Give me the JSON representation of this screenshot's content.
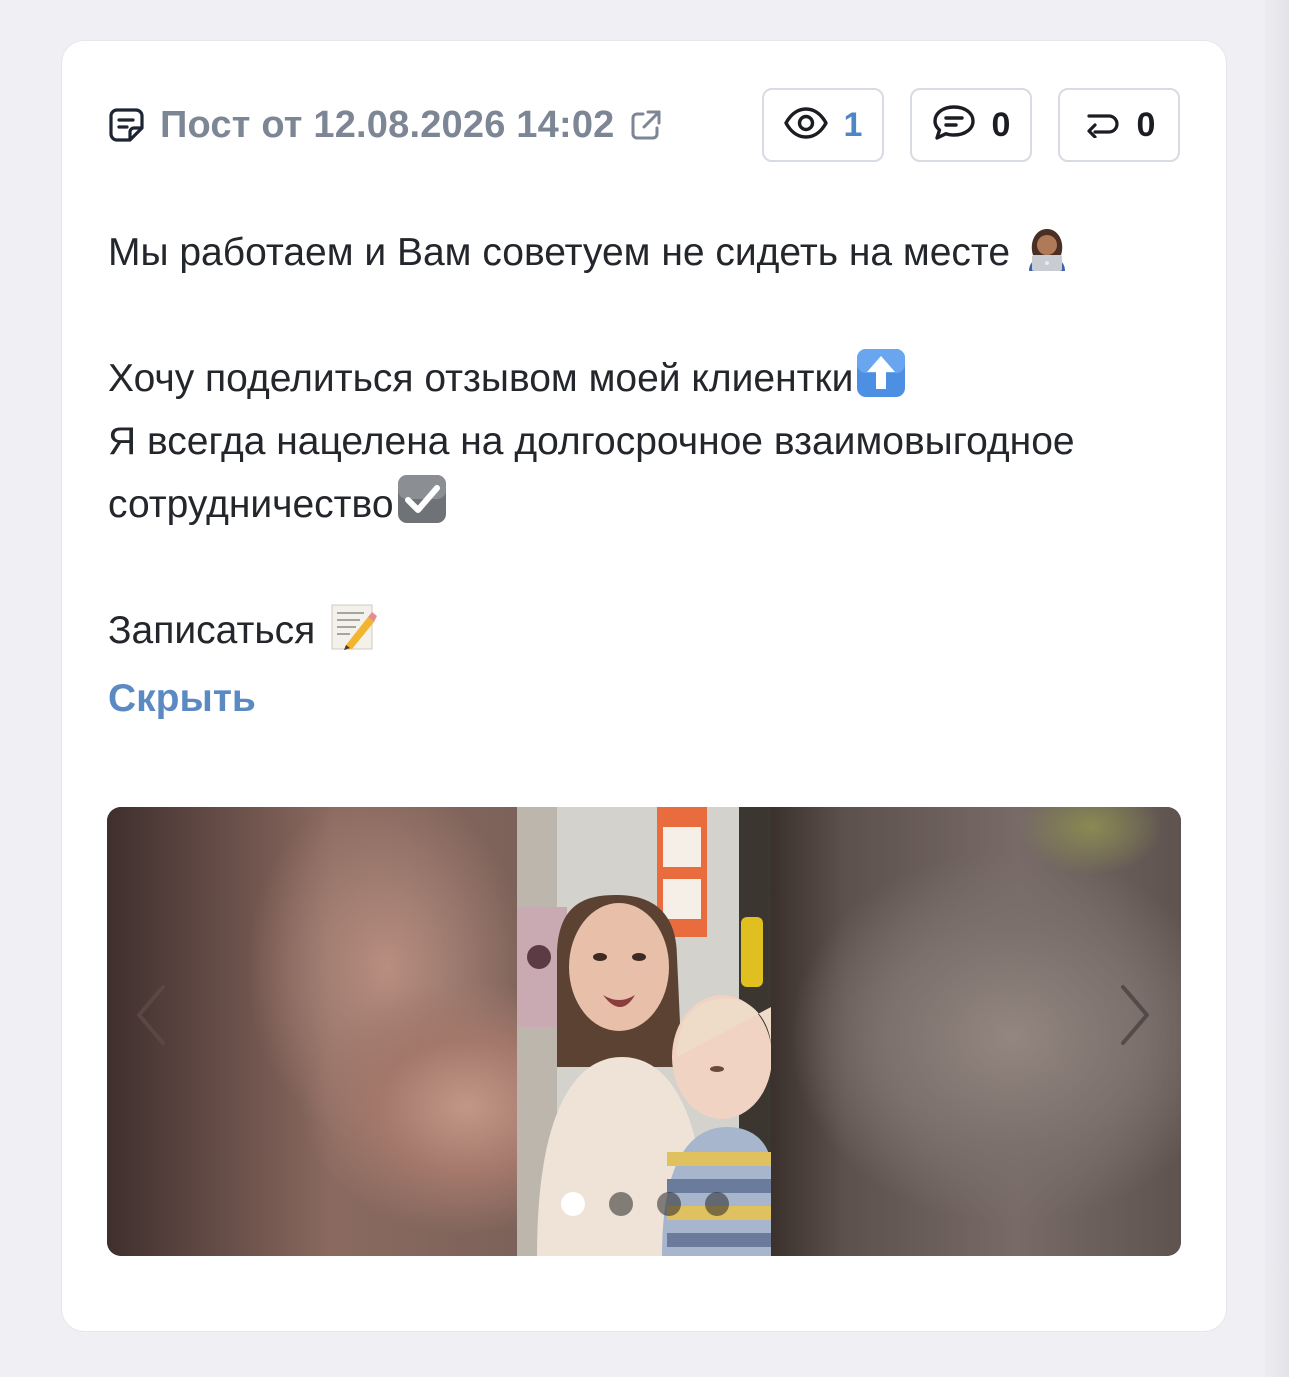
{
  "post": {
    "title": "Пост от 12.08.2026 14:02",
    "stats": {
      "views": "1",
      "comments": "0",
      "reposts": "0"
    },
    "text": {
      "line1": "Мы работаем и Вам советуем не сидеть на месте ",
      "line2": "Хочу поделиться отзывом моей клиентки",
      "line3": "Я всегда нацелена на долгосрочное взаимовыгодное",
      "line4": "сотрудничество",
      "line5": "Записаться "
    },
    "hide_label": "Скрыть"
  },
  "icons": {
    "post": "note-icon",
    "external": "external-link-icon",
    "views": "eye-icon",
    "comments": "comment-icon",
    "reposts": "repost-icon",
    "emoji1": "woman-technologist-emoji",
    "emoji2": "up-arrow-emoji",
    "emoji3": "check-box-emoji",
    "emoji4": "memo-emoji"
  },
  "carousel": {
    "slide_count": 4,
    "active_index": 0
  },
  "colors": {
    "accent": "#5b8ac3",
    "views_value": "#4f86c6",
    "muted_title": "#7d8694",
    "text": "#23262b",
    "border": "#d7dbe2",
    "background": "#efeff4"
  }
}
